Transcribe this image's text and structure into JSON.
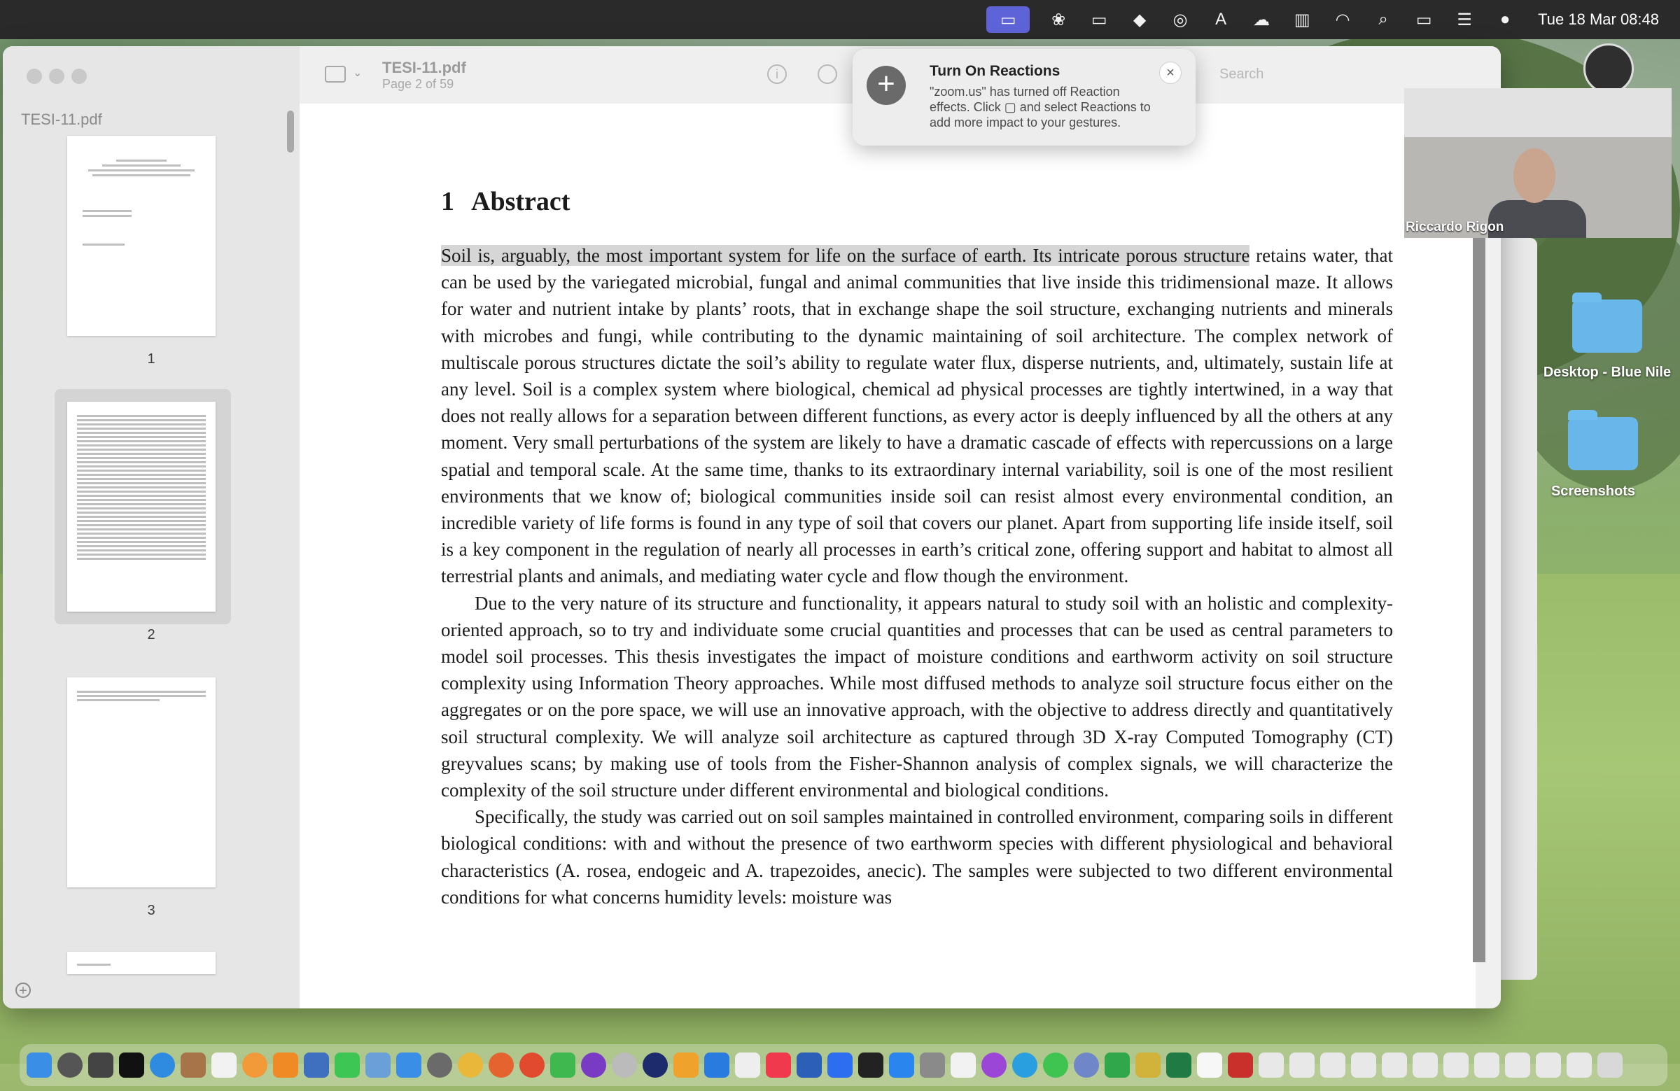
{
  "menubar": {
    "clock": "Tue 18 Mar 08:48"
  },
  "preview": {
    "sidebar_title": "TESI-11.pdf",
    "thumbnails": [
      {
        "page": "1"
      },
      {
        "page": "2",
        "selected": true
      },
      {
        "page": "3"
      }
    ],
    "doc_title": "TESI-11.pdf",
    "page_indicator": "Page 2 of 59",
    "search_placeholder": "Search"
  },
  "document": {
    "section_number": "1",
    "section_title": "Abstract",
    "paragraph_1_highlight": "Soil is, arguably, the most important system for life on the surface of earth. Its intricate porous structure",
    "paragraph_1_rest": " retains water, that can be used by the variegated microbial, fungal and animal communities that live inside this tridimensional maze. It allows for water and nutrient intake by plants’ roots, that in exchange shape the soil structure, exchanging nutrients and minerals with microbes and fungi, while contributing to the dynamic maintaining of soil architecture. The complex network of multiscale porous structures dictate the soil’s ability to regulate water flux, disperse nutrients, and, ultimately, sustain life at any level. Soil is a complex system where biological, chemical ad physical processes are tightly intertwined, in a way that does not really allows for a separation between different functions, as every actor is deeply influenced by all the others at any moment. Very small perturbations of the system are likely to have a dramatic cascade of effects with repercussions on a large spatial and temporal scale. At the same time, thanks to its extraordinary internal variability, soil is one of the most resilient environments that we know of; biological communities inside soil can resist almost every environmental condition, an incredible variety of life forms is found in any type of soil that covers our planet. Apart from supporting life inside itself, soil is a key component in the regulation of nearly all processes in earth’s critical zone, offering support and habitat to almost all terrestrial plants and animals, and mediating water cycle and flow though the environment.",
    "paragraph_2": "Due to the very nature of its structure and functionality, it appears natural to study soil with an holistic and complexity-oriented approach, so to try and individuate some crucial quantities and processes that can be used as central parameters to model soil processes. This thesis investigates the impact of moisture conditions and earthworm activity on soil structure complexity using Information Theory approaches. While most diffused methods to analyze soil structure focus either on the aggregates or on the pore space, we will use an innovative approach, with the objective to address directly and quantitatively soil structural complexity. We will analyze soil architecture as captured through 3D X-ray Computed Tomography (CT) greyvalues scans; by making use of tools from the Fisher-Shannon analysis of complex signals, we will characterize the complexity of the soil structure under different environmental and biological conditions.",
    "paragraph_3": "Specifically, the study was carried out on soil samples maintained in controlled environment, comparing soils in different biological conditions: with and without the presence of two earthworm species with different physiological and behavioral characteristics (A. rosea, endogeic and A. trapezoides, anecic). The samples were subjected to two different environmental conditions for what concerns humidity levels: moisture was"
  },
  "notification": {
    "title": "Turn On Reactions",
    "body": "\"zoom.us\" has turned off Reaction effects. Click ▢ and select Reactions to add more impact to your gestures."
  },
  "video": {
    "participant_name": "Riccardo Rigon"
  },
  "desktop": {
    "folders": [
      {
        "label": "Desktop - Blue Nile"
      },
      {
        "label": "Screenshots"
      }
    ]
  }
}
